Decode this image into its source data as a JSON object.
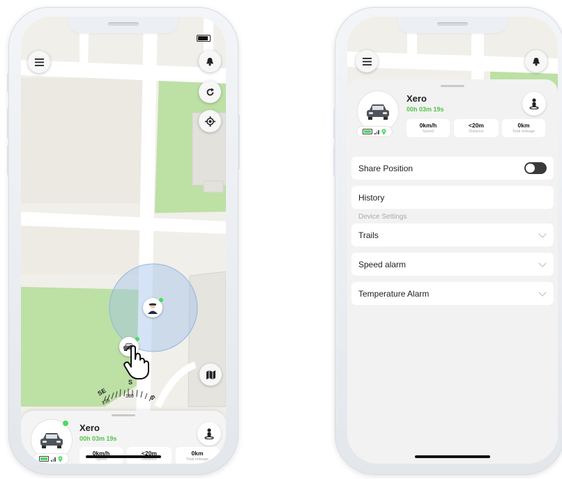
{
  "left_phone": {
    "device": {
      "name": "Xero",
      "duration": "00h 03m 19s",
      "stats": [
        {
          "value": "0km/h",
          "label": "Speed"
        },
        {
          "value": "<20m",
          "label": "Distance"
        },
        {
          "value": "0km",
          "label": "Total mileage"
        }
      ]
    },
    "compass": {
      "letters": [
        "SE",
        "S",
        "S"
      ],
      "degrees": [
        "135",
        "180"
      ]
    }
  },
  "right_phone": {
    "device": {
      "name": "Xero",
      "duration": "00h 03m 19s",
      "stats": [
        {
          "value": "0km/h",
          "label": "Speed"
        },
        {
          "value": "<20m",
          "label": "Distance"
        },
        {
          "value": "0km",
          "label": "Total mileage"
        }
      ]
    },
    "settings": {
      "share_position": "Share Position",
      "history": "History",
      "section_label": "Device Settings",
      "trails": "Trails",
      "speed_alarm": "Speed alarm",
      "temperature_alarm": "Temperature Alarm"
    }
  },
  "colors": {
    "accent_green": "#53c24a",
    "online_dot": "#4cd964",
    "park_green": "#bde0a5",
    "map_bg": "#f1efe9",
    "accuracy_circle": "#9fc0e8"
  },
  "icons": [
    "menu-icon",
    "bell-icon",
    "refresh-icon",
    "locate-icon",
    "map-icon",
    "person-pin-icon",
    "car-icon",
    "battery-icon",
    "signal-icon",
    "location-pin-icon",
    "chevron-down-icon",
    "hand-cursor-icon"
  ]
}
